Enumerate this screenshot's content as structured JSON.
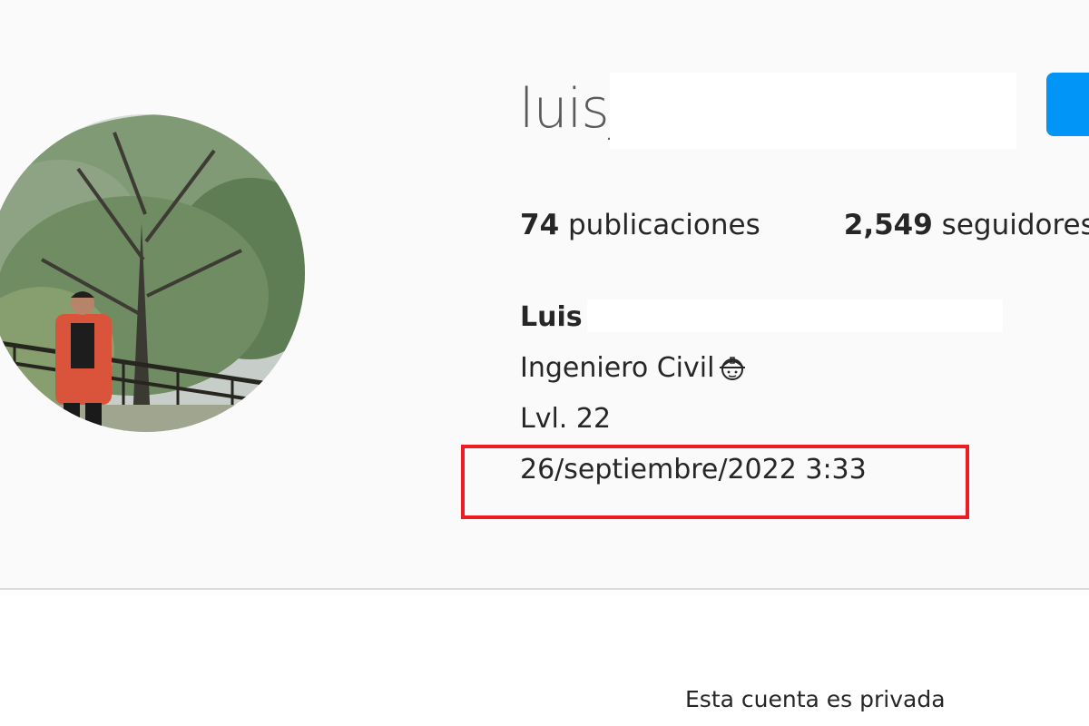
{
  "profile": {
    "username": "luis_",
    "avatar_alt": "profile photo",
    "follow_label": ""
  },
  "stats": {
    "posts_count": "74",
    "posts_label": " publicaciones",
    "followers_count": "2,549",
    "followers_label": " seguidores"
  },
  "bio": {
    "name": "Luis A",
    "line1": "Ingeniero Civil",
    "line1_icon": "construction-worker-emoji-icon",
    "line2": "Lvl. 22",
    "line3": "26/septiembre/2022 3:33"
  },
  "annotation": {
    "highlight_color": "#ee1c25"
  },
  "content": {
    "private_notice": "Esta cuenta es privada"
  },
  "colors": {
    "follow_button": "#0095f6",
    "header_bg": "#fafafa",
    "text": "#262626"
  }
}
